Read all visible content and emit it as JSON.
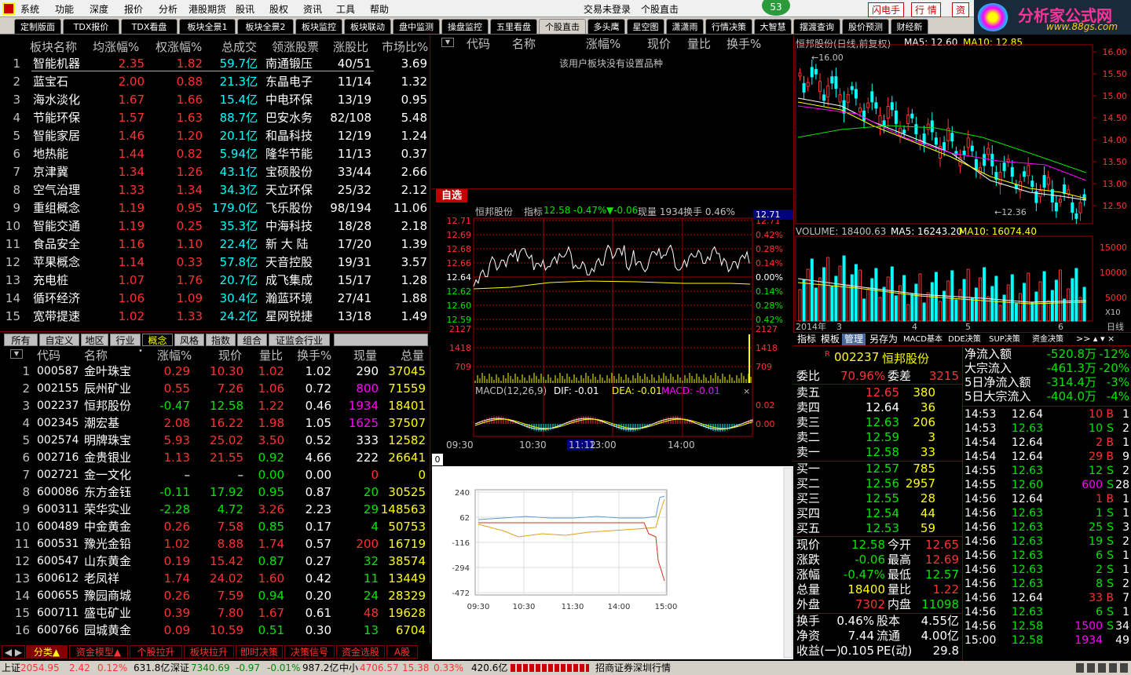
{
  "menu": [
    "系统",
    "功能",
    "深度",
    "报价",
    "分析",
    "港股期货",
    "股讯",
    "股权",
    "资讯",
    "工具",
    "帮助"
  ],
  "menu_right": {
    "trade": "交易未登录",
    "stock": "个股直击",
    "badge": "53",
    "flash": "闪电手",
    "quote": "行  情",
    "zi": "资"
  },
  "logo": {
    "text": "分析家公式网",
    "url": "www.88gs.com"
  },
  "tabs": [
    "定制版面",
    "TDX报价",
    "TDX看盘",
    "板块全景1",
    "板块全景2",
    "板块监控",
    "板块联动",
    "盘中监测",
    "操盘监控",
    "五里看盘",
    "个股直击",
    "多头鹰",
    "星空图",
    "潇潇雨",
    "行情决策",
    "大智慧",
    "摆渡查询",
    "股价预测",
    "财经新"
  ],
  "sector": {
    "headers": [
      "板块名称",
      "均涨幅%",
      "权涨幅%",
      "总成交",
      "领涨股票",
      "涨股比",
      "市场比%"
    ],
    "rows": [
      {
        "n": "1",
        "name": "智能机器",
        "avg": "2.35",
        "w": "1.82",
        "vol": "59.7亿",
        "lead": "南通锻压",
        "ratio": "40/51",
        "mkt": "3.69"
      },
      {
        "n": "2",
        "name": "蓝宝石",
        "avg": "2.00",
        "w": "0.88",
        "vol": "21.3亿",
        "lead": "东晶电子",
        "ratio": "11/14",
        "mkt": "1.32"
      },
      {
        "n": "3",
        "name": "海水淡化",
        "avg": "1.67",
        "w": "1.66",
        "vol": "15.4亿",
        "lead": "中电环保",
        "ratio": "13/19",
        "mkt": "0.95"
      },
      {
        "n": "4",
        "name": "节能环保",
        "avg": "1.57",
        "w": "1.63",
        "vol": "88.7亿",
        "lead": "巴安水务",
        "ratio": "82/108",
        "mkt": "5.48"
      },
      {
        "n": "5",
        "name": "智能家居",
        "avg": "1.46",
        "w": "1.20",
        "vol": "20.1亿",
        "lead": "和晶科技",
        "ratio": "12/19",
        "mkt": "1.24"
      },
      {
        "n": "6",
        "name": "地热能",
        "avg": "1.44",
        "w": "0.82",
        "vol": "5.94亿",
        "lead": "隆华节能",
        "ratio": "11/13",
        "mkt": "0.37"
      },
      {
        "n": "7",
        "name": "京津冀",
        "avg": "1.34",
        "w": "1.26",
        "vol": "43.1亿",
        "lead": "宝硕股份",
        "ratio": "33/44",
        "mkt": "2.66"
      },
      {
        "n": "8",
        "name": "空气治理",
        "avg": "1.33",
        "w": "1.34",
        "vol": "34.3亿",
        "lead": "天立环保",
        "ratio": "25/32",
        "mkt": "2.12"
      },
      {
        "n": "9",
        "name": "重组概念",
        "avg": "1.19",
        "w": "0.95",
        "vol": "179.0亿",
        "lead": "飞乐股份",
        "ratio": "98/194",
        "mkt": "11.06"
      },
      {
        "n": "10",
        "name": "智能交通",
        "avg": "1.19",
        "w": "0.25",
        "vol": "35.3亿",
        "lead": "中海科技",
        "ratio": "18/28",
        "mkt": "2.18"
      },
      {
        "n": "11",
        "name": "食品安全",
        "avg": "1.16",
        "w": "1.10",
        "vol": "22.4亿",
        "lead": "新 大 陆",
        "ratio": "17/20",
        "mkt": "1.39"
      },
      {
        "n": "12",
        "name": "苹果概念",
        "avg": "1.14",
        "w": "0.33",
        "vol": "57.8亿",
        "lead": "天音控股",
        "ratio": "19/31",
        "mkt": "3.57"
      },
      {
        "n": "13",
        "name": "充电桩",
        "avg": "1.07",
        "w": "1.76",
        "vol": "20.7亿",
        "lead": "成飞集成",
        "ratio": "15/17",
        "mkt": "1.28"
      },
      {
        "n": "14",
        "name": "循环经济",
        "avg": "1.06",
        "w": "1.09",
        "vol": "30.4亿",
        "lead": "瀚蓝环境",
        "ratio": "27/41",
        "mkt": "1.88"
      },
      {
        "n": "15",
        "name": "宽带提速",
        "avg": "1.02",
        "w": "1.33",
        "vol": "24.2亿",
        "lead": "星网锐捷",
        "ratio": "13/18",
        "mkt": "1.49"
      }
    ]
  },
  "subtabs": [
    "所有",
    "自定义",
    "地区",
    "行业",
    "概念",
    "风格",
    "指数",
    "组合",
    "证监会行业"
  ],
  "stocks": {
    "headers": [
      "代码",
      "名称",
      "涨幅%",
      "现价",
      "量比",
      "换手%",
      "现量",
      "总量"
    ],
    "rows": [
      {
        "n": "1",
        "code": "000587",
        "name": "金叶珠宝",
        "chg": "0.29",
        "price": "10.30",
        "vr": "1.02",
        "turn": "1.02",
        "cur": "290",
        "tot": "37045",
        "dir": "up",
        "cc": "wht"
      },
      {
        "n": "2",
        "code": "002155",
        "name": "辰州矿业",
        "chg": "0.55",
        "price": "7.26",
        "vr": "1.06",
        "turn": "0.72",
        "cur": "800",
        "tot": "71559",
        "dir": "up",
        "cc": "mag"
      },
      {
        "n": "3",
        "code": "002237",
        "name": "恒邦股份",
        "chg": "-0.47",
        "price": "12.58",
        "vr": "1.22",
        "turn": "0.46",
        "cur": "1934",
        "tot": "18401",
        "dir": "dn",
        "cc": "mag"
      },
      {
        "n": "4",
        "code": "002345",
        "name": "潮宏基",
        "chg": "2.08",
        "price": "16.22",
        "vr": "1.98",
        "turn": "1.05",
        "cur": "1625",
        "tot": "37507",
        "dir": "up",
        "cc": "mag"
      },
      {
        "n": "5",
        "code": "002574",
        "name": "明牌珠宝",
        "chg": "5.93",
        "price": "25.02",
        "vr": "3.50",
        "turn": "0.52",
        "cur": "333",
        "tot": "12582",
        "dir": "up",
        "cc": "wht"
      },
      {
        "n": "6",
        "code": "002716",
        "name": "金贵银业",
        "chg": "1.13",
        "price": "21.55",
        "vr": "0.92",
        "turn": "4.66",
        "cur": "222",
        "tot": "26641",
        "dir": "up",
        "cc": "wht"
      },
      {
        "n": "7",
        "code": "002721",
        "name": "金一文化",
        "chg": "–",
        "price": "–",
        "vr": "0.00",
        "turn": "0.00",
        "cur": "0",
        "tot": "0",
        "dir": "flat",
        "cc": "red"
      },
      {
        "n": "8",
        "code": "600086",
        "name": "东方金钰",
        "chg": "-0.11",
        "price": "17.92",
        "vr": "0.95",
        "turn": "0.87",
        "cur": "20",
        "tot": "30525",
        "dir": "dn",
        "cc": "grn"
      },
      {
        "n": "9",
        "code": "600311",
        "name": "荣华实业",
        "chg": "-2.28",
        "price": "4.72",
        "vr": "3.26",
        "turn": "2.23",
        "cur": "29",
        "tot": "148563",
        "dir": "dn",
        "cc": "grn"
      },
      {
        "n": "10",
        "code": "600489",
        "name": "中金黄金",
        "chg": "0.26",
        "price": "7.58",
        "vr": "0.85",
        "turn": "0.17",
        "cur": "4",
        "tot": "50753",
        "dir": "up",
        "cc": "grn"
      },
      {
        "n": "11",
        "code": "600531",
        "name": "豫光金铅",
        "chg": "1.02",
        "price": "8.88",
        "vr": "1.74",
        "turn": "0.57",
        "cur": "200",
        "tot": "16719",
        "dir": "up",
        "cc": "red"
      },
      {
        "n": "12",
        "code": "600547",
        "name": "山东黄金",
        "chg": "0.19",
        "price": "15.42",
        "vr": "0.87",
        "turn": "0.27",
        "cur": "32",
        "tot": "38574",
        "dir": "up",
        "cc": "grn"
      },
      {
        "n": "13",
        "code": "600612",
        "name": "老凤祥",
        "chg": "1.74",
        "price": "24.02",
        "vr": "1.60",
        "turn": "0.42",
        "cur": "11",
        "tot": "13449",
        "dir": "up",
        "cc": "grn"
      },
      {
        "n": "14",
        "code": "600655",
        "name": "豫园商城",
        "chg": "0.26",
        "price": "7.59",
        "vr": "0.94",
        "turn": "0.20",
        "cur": "24",
        "tot": "28329",
        "dir": "up",
        "cc": "grn"
      },
      {
        "n": "15",
        "code": "600711",
        "name": "盛屯矿业",
        "chg": "0.39",
        "price": "7.80",
        "vr": "1.67",
        "turn": "0.61",
        "cur": "48",
        "tot": "19628",
        "dir": "up",
        "cc": "red"
      },
      {
        "n": "16",
        "code": "600766",
        "name": "园城黄金",
        "chg": "0.09",
        "price": "10.59",
        "vr": "0.51",
        "turn": "0.30",
        "cur": "13",
        "tot": "6704",
        "dir": "up",
        "cc": "grn"
      }
    ]
  },
  "bottom_tabs": [
    "分类▲",
    "资金模型▲",
    "个股拉升",
    "板块拉升",
    "即时决策",
    "决策信号",
    "资金选股",
    "A股"
  ],
  "watch": {
    "headers": [
      "代码",
      "名称",
      "涨幅%",
      "现价",
      "量比",
      "换手%"
    ],
    "empty": "该用户板块没有设置品种",
    "tab": "自选"
  },
  "intraday": {
    "title": "恒邦股份",
    "label": "指标",
    "price": "12.58",
    "pct": "-0.47%",
    "chg": "▼-0.06",
    "cur": "现量 1934",
    "turn": "换手 0.46%",
    "left_axis": [
      "12.71",
      "12.69",
      "12.68",
      "12.66",
      "12.64",
      "12.62",
      "12.60",
      "12.59"
    ],
    "right_axis": [
      "12.71",
      "0.42%",
      "0.28%",
      "0.14%",
      "0.00%",
      "0.14%",
      "0.28%",
      "0.42%"
    ],
    "vol_axis": [
      "2127",
      "1418",
      "709"
    ],
    "macd": {
      "title": "MACD(12,26,9)",
      "dif": "DIF: -0.01",
      "dea": "DEA: -0.01",
      "macd": "MACD: -0.01",
      "axis": [
        "0.02",
        "0.00"
      ]
    },
    "times": [
      "09:30",
      "10:30",
      "11:12",
      "13:00",
      "14:00"
    ]
  },
  "flow": {
    "tab": "0",
    "axis": [
      "240",
      "62",
      "-116",
      "-294",
      "-472"
    ],
    "times": [
      "09:30",
      "10:30",
      "11:30",
      "14:00",
      "15:00"
    ]
  },
  "kline": {
    "title": "恒邦股份(日线,前复权)",
    "ma5": "MA5: 12.60",
    "ma10": "MA10: 12.85",
    "axis": [
      "16.00",
      "15.50",
      "15.00",
      "14.50",
      "14.00",
      "13.50",
      "13.00",
      "12.50"
    ],
    "hi": "16.00",
    "lo": "12.36",
    "vol": {
      "label": "VOLUME: 18400.63",
      "ma5": "MA5: 16243.20",
      "ma10": "MA10: 16074.40",
      "axis": [
        "15000",
        "10000",
        "5000"
      ],
      "unit": "X10"
    },
    "dates": [
      "2014年",
      "3",
      "4",
      "5",
      "6"
    ],
    "right": "日线"
  },
  "f10tabs": [
    "指标",
    "模板",
    "管理",
    "另存为",
    "MACD基本",
    "DDE决策",
    "SUP决策",
    "资金决策"
  ],
  "quote": {
    "code": "002237",
    "name": "恒邦股份",
    "wb": "70.96%",
    "wc": "3215",
    "sell": [
      {
        "l": "卖五",
        "p": "12.65",
        "v": "380"
      },
      {
        "l": "卖四",
        "p": "12.64",
        "v": "36"
      },
      {
        "l": "卖三",
        "p": "12.63",
        "v": "206"
      },
      {
        "l": "卖二",
        "p": "12.59",
        "v": "3"
      },
      {
        "l": "卖一",
        "p": "12.58",
        "v": "33"
      }
    ],
    "buy": [
      {
        "l": "买一",
        "p": "12.57",
        "v": "785"
      },
      {
        "l": "买二",
        "p": "12.56",
        "v": "2957"
      },
      {
        "l": "买三",
        "p": "12.55",
        "v": "28"
      },
      {
        "l": "买四",
        "p": "12.54",
        "v": "44"
      },
      {
        "l": "买五",
        "p": "12.53",
        "v": "59"
      }
    ],
    "stats": [
      [
        "现价",
        "12.58",
        "今开",
        "12.65"
      ],
      [
        "涨跌",
        "-0.06",
        "最高",
        "12.69"
      ],
      [
        "涨幅",
        "-0.47%",
        "最低",
        "12.57"
      ],
      [
        "总量",
        "18400",
        "量比",
        "1.22"
      ],
      [
        "外盘",
        "7302",
        "内盘",
        "11098"
      ]
    ],
    "stats2": [
      [
        "换手",
        "0.46%",
        "股本",
        "4.55亿"
      ],
      [
        "净资",
        "7.44",
        "流通",
        "4.00亿"
      ],
      [
        "收益(一)",
        "0.105",
        "PE(动)",
        "29.8"
      ]
    ]
  },
  "fund": [
    {
      "l": "净流入额",
      "v": "-520.8万",
      "p": "-12%"
    },
    {
      "l": "大宗流入",
      "v": "-461.3万",
      "p": "-20%"
    },
    {
      "l": "5日净流入额",
      "v": "-314.4万",
      "p": "-3%"
    },
    {
      "l": "5日大宗流入",
      "v": "-404.0万",
      "p": "-4%"
    }
  ],
  "ticks": [
    [
      "14:53",
      "12.64",
      "10",
      "B",
      "1"
    ],
    [
      "14:53",
      "12.63",
      "10",
      "S",
      "2"
    ],
    [
      "14:54",
      "12.64",
      "2",
      "B",
      "1"
    ],
    [
      "14:54",
      "12.64",
      "29",
      "B",
      "9"
    ],
    [
      "14:55",
      "12.63",
      "12",
      "S",
      "2"
    ],
    [
      "14:55",
      "12.60",
      "600",
      "S",
      "28"
    ],
    [
      "14:56",
      "12.64",
      "1",
      "B",
      "1"
    ],
    [
      "14:56",
      "12.63",
      "1",
      "S",
      "1"
    ],
    [
      "14:56",
      "12.63",
      "25",
      "S",
      "3"
    ],
    [
      "14:56",
      "12.63",
      "19",
      "S",
      "2"
    ],
    [
      "14:56",
      "12.63",
      "6",
      "S",
      "1"
    ],
    [
      "14:56",
      "12.63",
      "2",
      "S",
      "1"
    ],
    [
      "14:56",
      "12.63",
      "8",
      "S",
      "2"
    ],
    [
      "14:56",
      "12.64",
      "33",
      "B",
      "7"
    ],
    [
      "14:56",
      "12.63",
      "6",
      "S",
      "1"
    ],
    [
      "14:56",
      "12.58",
      "1500",
      "S",
      "34"
    ],
    [
      "15:00",
      "12.58",
      "1934",
      "",
      "49"
    ]
  ],
  "status": {
    "sh": "上证",
    "shv": "2054.95",
    "shc": "2.42",
    "shp": "0.12%",
    "sha": "631.8亿",
    "sz": "深证",
    "szv": "7340.69",
    "szc": "-0.97",
    "szp": "-0.01%",
    "sza": "987.2亿",
    "zx": "中小",
    "zxv": "4706.57",
    "zxc": "15.38",
    "zxp": "0.33%",
    "zxa": "420.6亿",
    "broker": "招商证券深圳行情"
  }
}
